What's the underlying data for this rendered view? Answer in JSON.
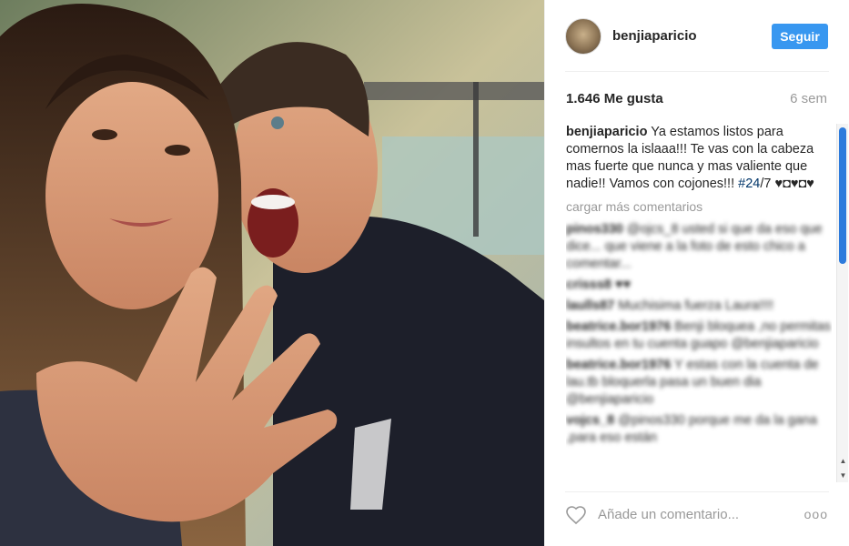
{
  "post": {
    "username": "benjiaparicio",
    "follow_label": "Seguir",
    "likes": "1.646 Me gusta",
    "time_ago": "6 sem",
    "caption_user": "benjiaparicio",
    "caption_text": " Ya estamos listos para comernos la islaaa!!! Te vas con la cabeza mas fuerte que nunca y mas valiente que nadie!! Vamos con cojones!!! ",
    "caption_hashtag": "#24",
    "caption_tail": "/7 ♥◘♥◘♥",
    "load_more": "cargar más comentarios",
    "comments": [
      {
        "user": "pinos330",
        "text": " @ojcs_8 usted si que da eso que dice... que viene a la foto de esto chico a comentar..."
      },
      {
        "user": "crisss8",
        "text": " ♥♥"
      },
      {
        "user": "laulls87",
        "text": " Muchisima fuerza Laura!!!!"
      },
      {
        "user": "beatrice.bor1976",
        "text": " Benji bloquea ,no permitas insultos en tu cuenta guapo @benjiaparicio"
      },
      {
        "user": "beatrice.bor1976",
        "text": " Y estas con la cuenta de lau.tb bloquerla pasa un buen dia @benjiaparicio"
      },
      {
        "user": "vojcs_8",
        "text": " @pinos330 porque me da la gana ,para eso están"
      }
    ],
    "add_comment_placeholder": "Añade un comentario...",
    "more_label": "ooo"
  },
  "colors": {
    "accent": "#3897f0",
    "hashtag": "#003569",
    "muted": "#999999"
  },
  "icons": {
    "heart": "heart-icon",
    "more": "more-options-icon",
    "scroll_up": "scroll-up-arrow-icon",
    "scroll_down": "scroll-down-arrow-icon"
  }
}
